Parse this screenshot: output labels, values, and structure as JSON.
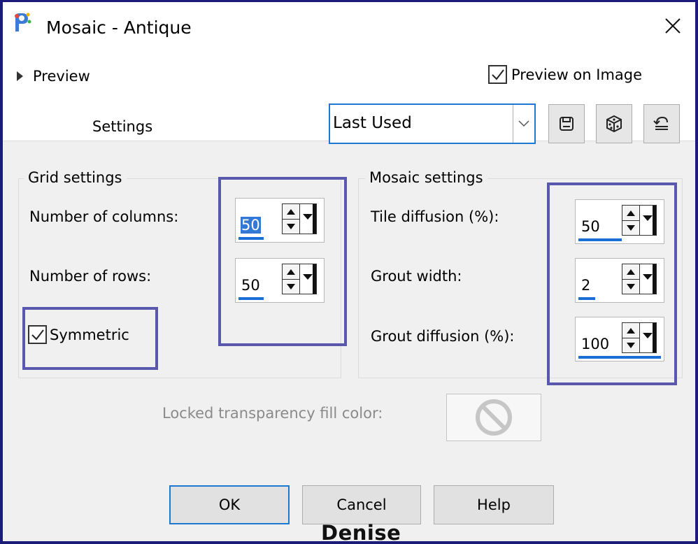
{
  "window": {
    "title": "Mosaic - Antique",
    "close_icon": "close-icon",
    "app_icon": "paintshop-pro-icon"
  },
  "preview": {
    "label": "Preview",
    "expanded": false,
    "preview_on_image_label": "Preview on Image",
    "preview_on_image_checked": true
  },
  "settings": {
    "label": "Settings",
    "preset_value": "Last Used",
    "tools": [
      "save-preset-icon",
      "randomize-icon",
      "reset-icon"
    ]
  },
  "grid": {
    "title": "Grid settings",
    "columns_label": "Number of columns:",
    "columns_value": "50",
    "rows_label": "Number of rows:",
    "rows_value": "50",
    "symmetric_label": "Symmetric",
    "symmetric_checked": true
  },
  "mosaic": {
    "title": "Mosaic settings",
    "tile_diffusion_label": "Tile diffusion (%):",
    "tile_diffusion_value": "50",
    "grout_width_label": "Grout width:",
    "grout_width_value": "2",
    "grout_diffusion_label": "Grout diffusion (%):",
    "grout_diffusion_value": "100"
  },
  "locked": {
    "label": "Locked transparency fill color:",
    "icon": "no-color-icon"
  },
  "buttons": {
    "ok": "OK",
    "cancel": "Cancel",
    "help": "Help"
  },
  "signature": "Denise",
  "colors": {
    "frame": "#1b1c7a",
    "highlight": "#5a58ad",
    "accent": "#1e78d2",
    "dialog_bg": "#f0f0f0"
  }
}
